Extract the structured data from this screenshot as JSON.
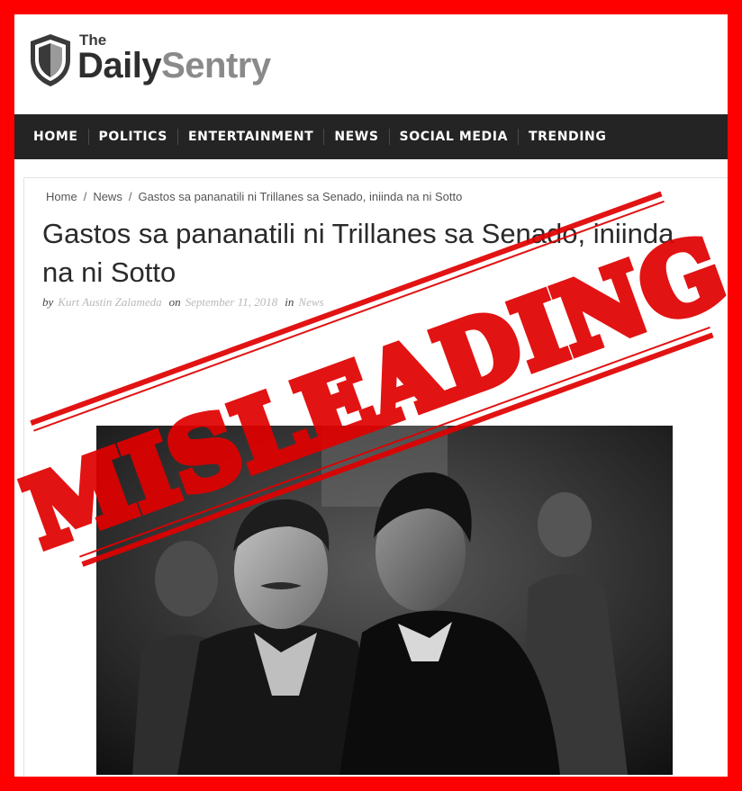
{
  "logo": {
    "the": "The",
    "daily": "Daily",
    "sentry": "Sentry"
  },
  "nav": [
    "HOME",
    "POLITICS",
    "ENTERTAINMENT",
    "NEWS",
    "SOCIAL MEDIA",
    "TRENDING"
  ],
  "breadcrumb": {
    "home": "Home",
    "section": "News",
    "current": "Gastos sa pananatili ni Trillanes sa Senado, iniinda na ni Sotto"
  },
  "article": {
    "title": "Gastos sa pananatili ni Trillanes sa Senado, iniinda na ni Sotto",
    "by_label": "by",
    "author": "Kurt Austin Zalameda",
    "on_label": "on",
    "date": "September 11, 2018",
    "in_label": "in",
    "category": "News"
  },
  "stamp": {
    "text": "MISLEADING",
    "color": "#e00000"
  },
  "colors": {
    "frame": "#ff0000",
    "navbar": "#242424",
    "meta_link": "#b9b9b9"
  }
}
